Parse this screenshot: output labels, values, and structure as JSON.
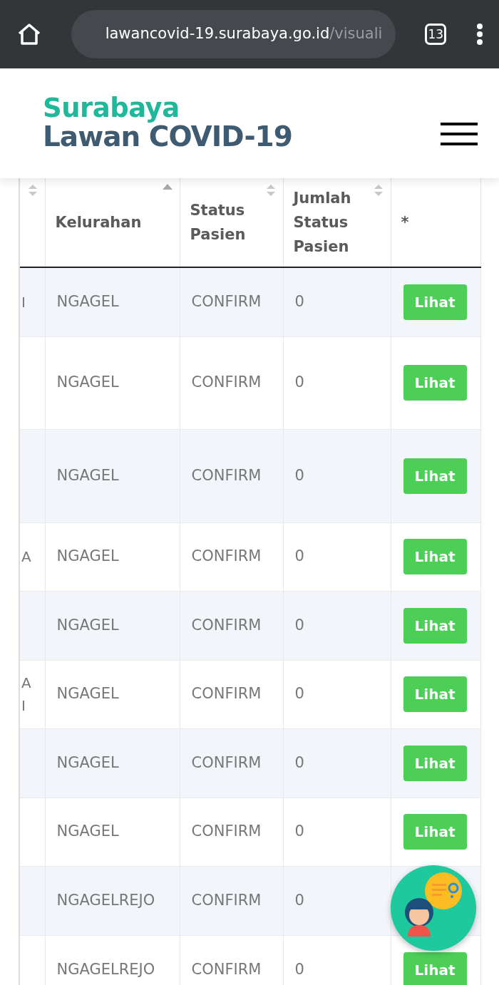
{
  "browser": {
    "url_host": "lawancovid-19.surabaya.go.id",
    "url_path": "/visuali",
    "tab_count": "13"
  },
  "header": {
    "logo_line_1": "Surabaya",
    "logo_line_2": "Lawan COVID-19"
  },
  "table": {
    "columns": [
      {
        "sortable": true,
        "sorted": false
      },
      {
        "label": "Kelurahan",
        "sortable": true,
        "sorted": true
      },
      {
        "label": "Status Pasien",
        "sortable": true,
        "sorted": false
      },
      {
        "label": "Jumlah Status Pasien",
        "sortable": true,
        "sorted": false
      },
      {
        "label": "*"
      }
    ],
    "rows": [
      {
        "column_1": "I",
        "kelurahan": "NGAGEL",
        "status": "CONFIRM",
        "jumlah": "0",
        "action": "Lihat"
      },
      {
        "kelurahan": "NGAGEL",
        "status": "CONFIRM",
        "jumlah": "0",
        "action": "Lihat"
      },
      {
        "kelurahan": "NGAGEL",
        "status": "CONFIRM",
        "jumlah": "0",
        "action": "Lihat"
      },
      {
        "column_1": "A",
        "kelurahan": "NGAGEL",
        "status": "CONFIRM",
        "jumlah": "0",
        "action": "Lihat"
      },
      {
        "kelurahan": "NGAGEL",
        "status": "CONFIRM",
        "jumlah": "0",
        "action": "Lihat"
      },
      {
        "column_1": "A I",
        "kelurahan": "NGAGEL",
        "status": "CONFIRM",
        "jumlah": "0",
        "action": "Lihat"
      },
      {
        "kelurahan": "NGAGEL",
        "status": "CONFIRM",
        "jumlah": "0",
        "action": "Lihat"
      },
      {
        "kelurahan": "NGAGEL",
        "status": "CONFIRM",
        "jumlah": "0",
        "action": "Lihat"
      },
      {
        "kelurahan": "NGAGELREJO",
        "status": "CONFIRM",
        "jumlah": "0"
      },
      {
        "kelurahan": "NGAGELREJO",
        "status": "CONFIRM",
        "jumlah": "0",
        "action": "Lihat"
      }
    ]
  }
}
